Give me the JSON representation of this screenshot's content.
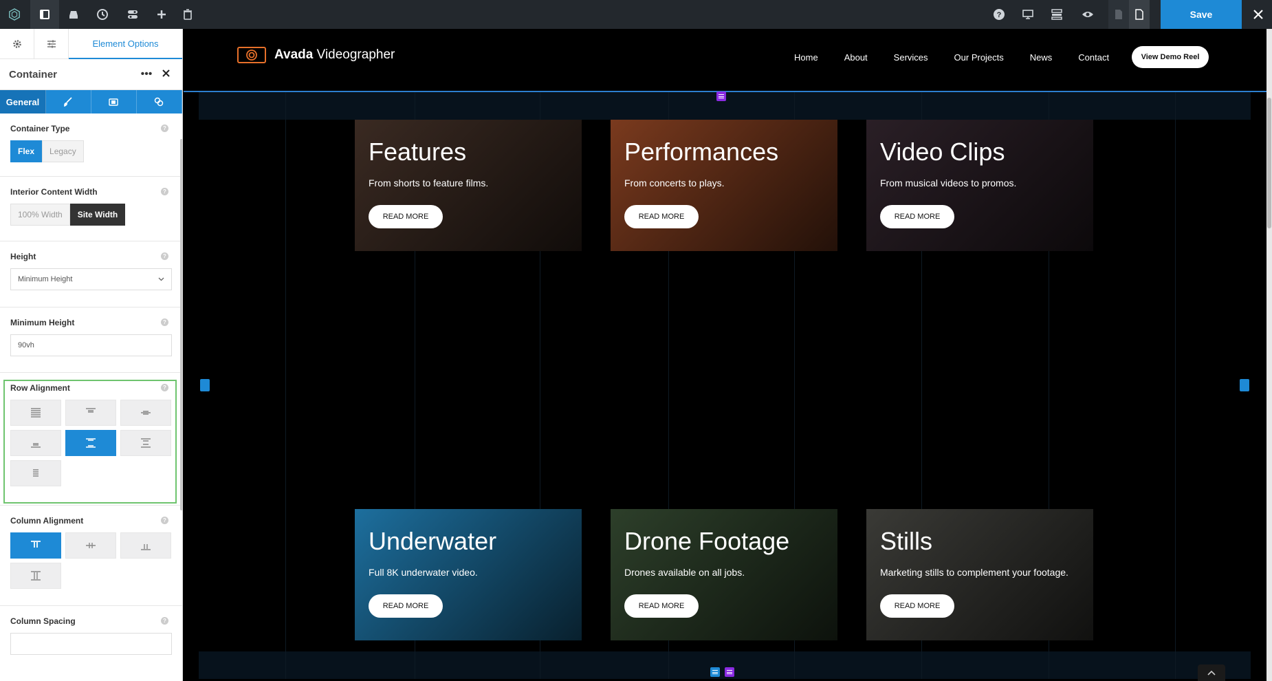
{
  "toolbar": {
    "save_label": "Save"
  },
  "sidebar": {
    "tab_label": "Element Options",
    "header_title": "Container",
    "subtabs": {
      "general": "General"
    },
    "container_type": {
      "label": "Container Type",
      "options": [
        "Flex",
        "Legacy"
      ],
      "selected": "Flex"
    },
    "interior_width": {
      "label": "Interior Content Width",
      "options": [
        "100% Width",
        "Site Width"
      ],
      "selected": "Site Width"
    },
    "height": {
      "label": "Height",
      "value": "Minimum Height"
    },
    "min_height": {
      "label": "Minimum Height",
      "value": "90vh"
    },
    "row_alignment": {
      "label": "Row Alignment",
      "selected_index": 4
    },
    "column_alignment": {
      "label": "Column Alignment",
      "selected_index": 0
    },
    "column_spacing": {
      "label": "Column Spacing",
      "value": ""
    }
  },
  "site": {
    "logo_bold": "Avada",
    "logo_rest": "Videographer",
    "nav": [
      "Home",
      "About",
      "Services",
      "Our Projects",
      "News",
      "Contact"
    ],
    "cta": "View Demo Reel"
  },
  "cards": [
    {
      "title": "Features",
      "subtitle": "From shorts to feature films.",
      "button": "READ MORE",
      "bg": "#3a2a22"
    },
    {
      "title": "Performances",
      "subtitle": "From concerts to plays.",
      "button": "READ MORE",
      "bg": "#7a3a1e"
    },
    {
      "title": "Video Clips",
      "subtitle": "From musical videos to promos.",
      "button": "READ MORE",
      "bg": "#2a1f26"
    },
    {
      "title": "Underwater",
      "subtitle": "Full 8K underwater video.",
      "button": "READ MORE",
      "bg": "#1d6f9e"
    },
    {
      "title": "Drone Footage",
      "subtitle": "Drones available on all jobs.",
      "button": "READ MORE",
      "bg": "#2d3f2a"
    },
    {
      "title": "Stills",
      "subtitle": "Marketing stills to complement your footage.",
      "button": "READ MORE",
      "bg": "#3a3a36"
    }
  ],
  "colors": {
    "accent": "#1e8ad6",
    "topbar": "#23282d",
    "logo_orange": "#e7702a",
    "highlight_green": "#6ec46e"
  }
}
